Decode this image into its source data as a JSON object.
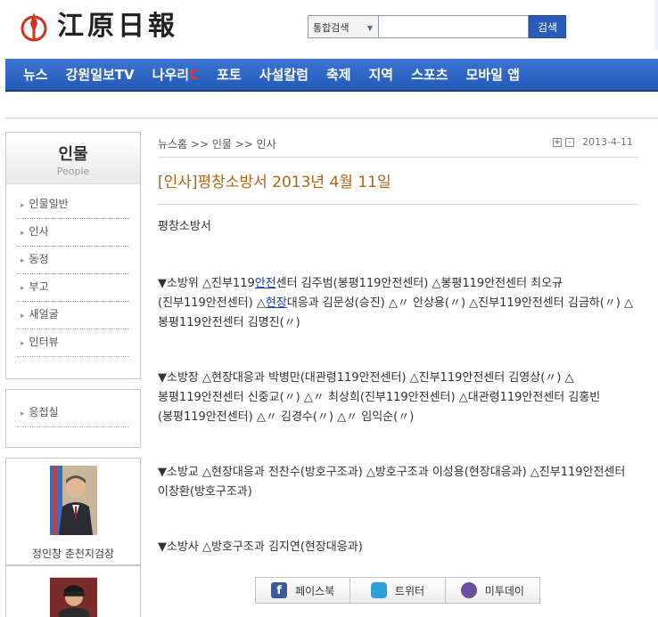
{
  "header": {
    "logo_text": "江原日報",
    "search": {
      "scope": "통합검색",
      "value": "",
      "button_label": "검색"
    }
  },
  "nav": {
    "items": [
      "뉴스",
      "강원일보TV",
      "나우리",
      "포토",
      "사설칼럼",
      "축제",
      "지역",
      "스포츠",
      "모바일 앱"
    ],
    "nauri_suffix": "C"
  },
  "sidebar": {
    "title_ko": "인물",
    "title_en": "People",
    "items": [
      "인물일반",
      "인사",
      "동정",
      "부고",
      "새얼굴",
      "인터뷰"
    ],
    "extra_item": "응접실",
    "person_name": "정인창 춘천지검장"
  },
  "article": {
    "breadcrumb": "뉴스홈 >> 인물 >> 인사",
    "zoom_in": "+",
    "zoom_out": "-",
    "date": "2013-4-11",
    "title": "[인사]평창소방서 2013년 4월 11일",
    "org": "평창소방서",
    "p1_pre": "▼소방위 △진부119",
    "p1_link": "안전",
    "p1_mid": "센터 김주범(봉평119안전센터) △봉평119안전센터 최오규(진부119안전센터) △",
    "p1_link2": "현장",
    "p1_post": "대응과 김문성(승진) △〃 안상용(〃) △진부119안전센터 김금하(〃) △봉평119안전센터 김명진(〃)",
    "p2": "▼소방장 △현장대응과 박병만(대관령119안전센터) △진부119안전센터 김영상(〃) △봉평119안전센터 신중교(〃) △〃 최상희(진부119안전센터) △대관령119안전센터 김홍빈(봉평119안전센터) △〃 김경수(〃) △〃 임익순(〃)",
    "p3": "▼소방교 △현장대응과 전찬수(방호구조과) △방호구조과 이성용(현장대응과) △진부119안전센터 이창환(방호구조과)",
    "p4": "▼소방사 △방호구조과 김지연(현장대응과)"
  },
  "share": {
    "facebook": "페이스북",
    "twitter": "트위터",
    "me2day": "미투데이"
  },
  "colors": {
    "nav": "#2d64c4",
    "title": "#b46514",
    "logo_red": "#d6311e"
  }
}
